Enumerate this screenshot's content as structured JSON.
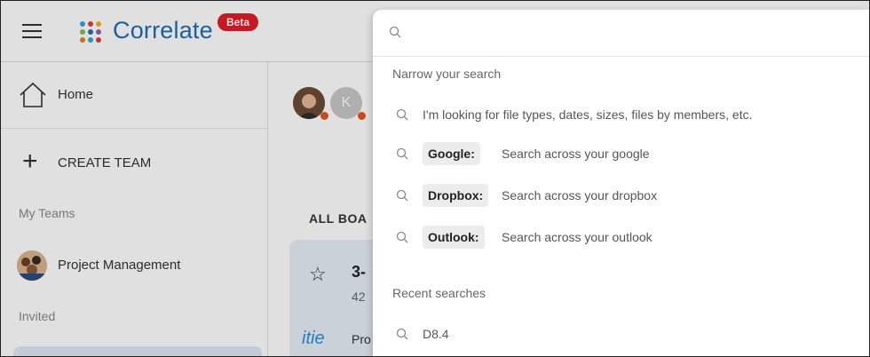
{
  "app": {
    "name": "Correlate",
    "badge": "Beta",
    "brand_color": "#1f6fb2",
    "badge_color": "#e11d2a"
  },
  "sidebar": {
    "home_label": "Home",
    "create_team_label": "CREATE TEAM",
    "my_teams_label": "My Teams",
    "teams": [
      {
        "label": "Project Management"
      }
    ],
    "invited_label": "Invited"
  },
  "main": {
    "user2_initial": "K",
    "all_boards_label": "ALL BOA",
    "board_title": "3-",
    "board_sub": "42",
    "board_logo": "itie",
    "board_line": "Pro"
  },
  "search": {
    "value": "",
    "narrow_header": "Narrow your search",
    "hint": "I'm looking for file types, dates, sizes, files by members, etc.",
    "sources": [
      {
        "chip": "Google:",
        "desc": "Search across your google"
      },
      {
        "chip": "Dropbox:",
        "desc": "Search across your dropbox"
      },
      {
        "chip": "Outlook:",
        "desc": "Search across your outlook"
      }
    ],
    "recent_header": "Recent searches",
    "recent": [
      {
        "label": "D8.4"
      }
    ]
  }
}
